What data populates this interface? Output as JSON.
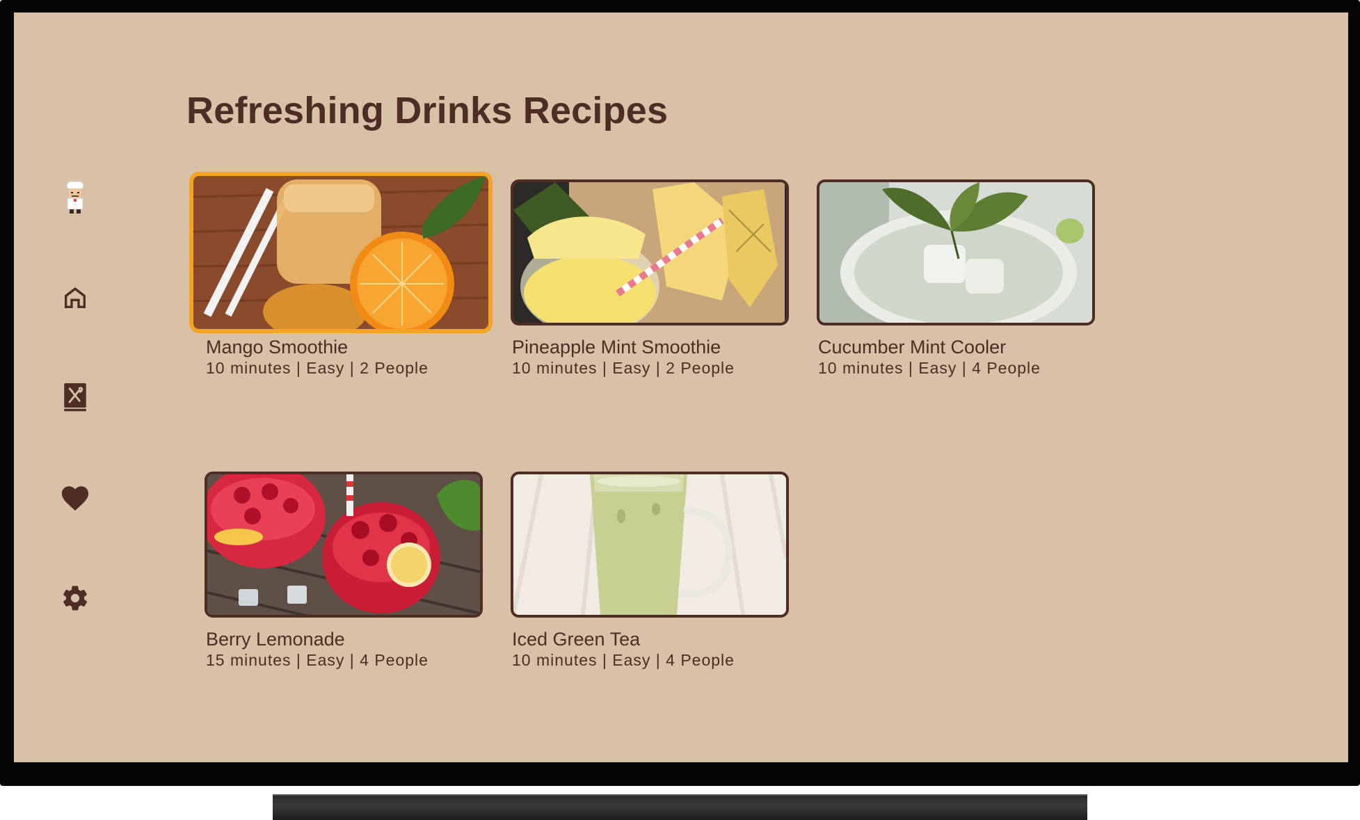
{
  "page": {
    "title": "Refreshing Drinks Recipes"
  },
  "nav": {
    "items": [
      {
        "icon": "chef-avatar-icon",
        "label": ""
      },
      {
        "icon": "home-icon",
        "label": ""
      },
      {
        "icon": "recipe-book-icon",
        "label": ""
      },
      {
        "icon": "heart-icon",
        "label": ""
      },
      {
        "icon": "gear-icon",
        "label": ""
      }
    ]
  },
  "recipes": [
    {
      "name": "Mango Smoothie",
      "meta": "10 minutes | Easy | 2 People",
      "focused": true
    },
    {
      "name": "Pineapple Mint Smoothie",
      "meta": "10 minutes | Easy | 2 People",
      "focused": false
    },
    {
      "name": "Cucumber Mint Cooler",
      "meta": "10 minutes | Easy | 4 People",
      "focused": false
    },
    {
      "name": "Berry Lemonade",
      "meta": "15 minutes | Easy | 4 People",
      "focused": false
    },
    {
      "name": "Iced Green Tea",
      "meta": "10 minutes | Easy | 4 People",
      "focused": false
    }
  ],
  "colors": {
    "background": "#d9c1a8",
    "text": "#4d2d24",
    "focus": "#f4a323",
    "frame": "#050505"
  }
}
